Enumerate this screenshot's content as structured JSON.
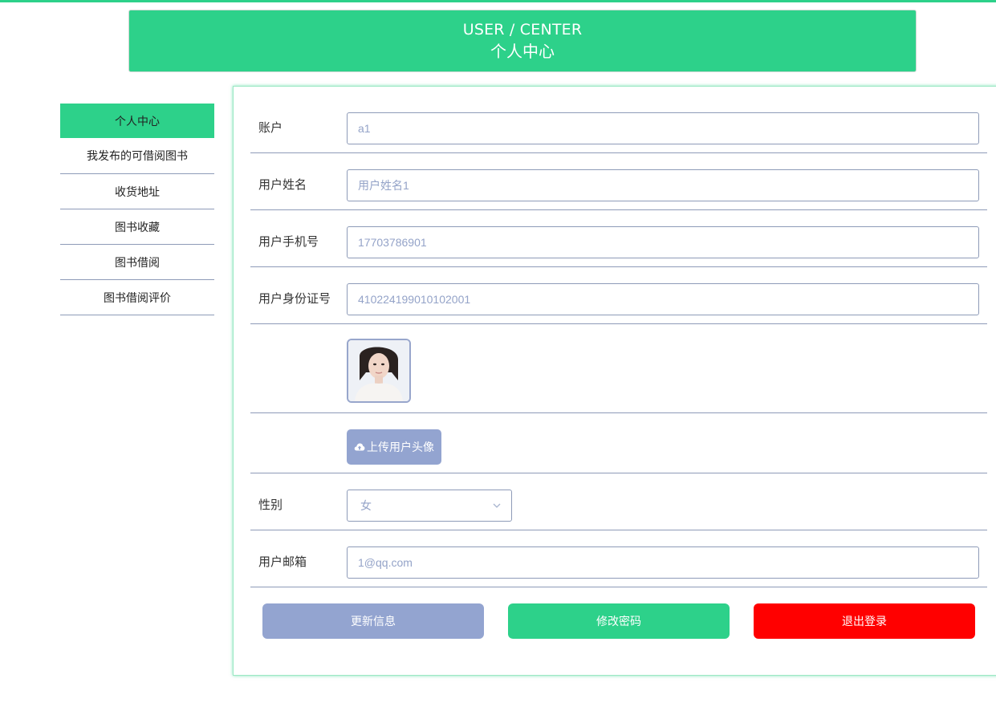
{
  "colors": {
    "accent": "#2dd18a",
    "muted_button": "#93a4d0",
    "danger": "#ff0000",
    "border": "#8e9bb8"
  },
  "banner": {
    "title_en": "USER / CENTER",
    "title_cn": "个人中心"
  },
  "sidebar": {
    "items": [
      {
        "label": "个人中心",
        "active": true
      },
      {
        "label": "我发布的可借阅图书"
      },
      {
        "label": "收货地址"
      },
      {
        "label": "图书收藏"
      },
      {
        "label": "图书借阅"
      },
      {
        "label": "图书借阅评价"
      }
    ]
  },
  "form": {
    "account": {
      "label": "账户",
      "value": "a1"
    },
    "name": {
      "label": "用户姓名",
      "value": "用户姓名1"
    },
    "phone": {
      "label": "用户手机号",
      "value": "17703786901"
    },
    "idcard": {
      "label": "用户身份证号",
      "value": "410224199010102001"
    },
    "avatar": {
      "icon": "avatar-photo"
    },
    "upload": {
      "label": "上传用户头像",
      "icon": "cloud-upload-icon"
    },
    "gender": {
      "label": "性别",
      "value": "女"
    },
    "email": {
      "label": "用户邮箱",
      "value": "1@qq.com"
    }
  },
  "actions": {
    "update": "更新信息",
    "change_password": "修改密码",
    "logout": "退出登录"
  }
}
